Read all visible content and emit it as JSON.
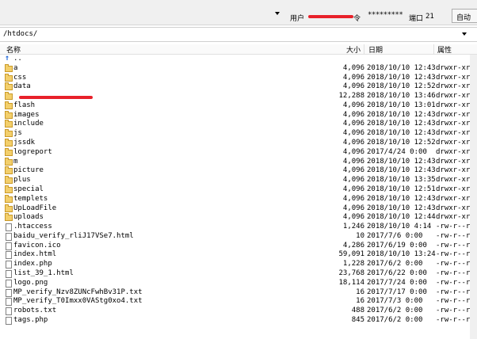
{
  "connection": {
    "user_label": "用户",
    "password_label": "令",
    "password_value": "*********",
    "port_label": "端口",
    "port_value": "21",
    "auto_button": "自动"
  },
  "remote": {
    "path": "/htdocs/"
  },
  "columns": {
    "name": "名称",
    "size": "大小",
    "date": "日期",
    "perm": "属性"
  },
  "files": [
    {
      "name": "..",
      "size": "",
      "date": "",
      "perm": "",
      "type": "up"
    },
    {
      "name": "a",
      "size": "4,096",
      "date": "2018/10/10 12:43",
      "perm": "drwxr-xr-x",
      "type": "folder"
    },
    {
      "name": "css",
      "size": "4,096",
      "date": "2018/10/10 12:43",
      "perm": "drwxr-xr-x",
      "type": "folder"
    },
    {
      "name": "data",
      "size": "4,096",
      "date": "2018/10/10 12:52",
      "perm": "drwxr-xr-x",
      "type": "folder"
    },
    {
      "name": "",
      "size": "12,288",
      "date": "2018/10/10 13:46",
      "perm": "drwxr-xr-x",
      "type": "folder",
      "redacted": true
    },
    {
      "name": "flash",
      "size": "4,096",
      "date": "2018/10/10 13:01",
      "perm": "drwxr-xr-x",
      "type": "folder"
    },
    {
      "name": "images",
      "size": "4,096",
      "date": "2018/10/10 12:43",
      "perm": "drwxr-xr-x",
      "type": "folder"
    },
    {
      "name": "include",
      "size": "4,096",
      "date": "2018/10/10 12:43",
      "perm": "drwxr-xr-x",
      "type": "folder"
    },
    {
      "name": "js",
      "size": "4,096",
      "date": "2018/10/10 12:43",
      "perm": "drwxr-xr-x",
      "type": "folder"
    },
    {
      "name": "jssdk",
      "size": "4,096",
      "date": "2018/10/10 12:52",
      "perm": "drwxr-xr-x",
      "type": "folder"
    },
    {
      "name": "logreport",
      "size": "4,096",
      "date": "2017/4/24 0:00",
      "perm": "drwxr-xr-x",
      "type": "folder"
    },
    {
      "name": "m",
      "size": "4,096",
      "date": "2018/10/10 12:43",
      "perm": "drwxr-xr-x",
      "type": "folder"
    },
    {
      "name": "picture",
      "size": "4,096",
      "date": "2018/10/10 12:43",
      "perm": "drwxr-xr-x",
      "type": "folder"
    },
    {
      "name": "plus",
      "size": "4,096",
      "date": "2018/10/10 13:35",
      "perm": "drwxr-xr-x",
      "type": "folder"
    },
    {
      "name": "special",
      "size": "4,096",
      "date": "2018/10/10 12:51",
      "perm": "drwxr-xr-x",
      "type": "folder"
    },
    {
      "name": "templets",
      "size": "4,096",
      "date": "2018/10/10 12:43",
      "perm": "drwxr-xr-x",
      "type": "folder"
    },
    {
      "name": "UpLoadFile",
      "size": "4,096",
      "date": "2018/10/10 12:43",
      "perm": "drwxr-xr-x",
      "type": "folder"
    },
    {
      "name": "uploads",
      "size": "4,096",
      "date": "2018/10/10 12:44",
      "perm": "drwxr-xr-x",
      "type": "folder"
    },
    {
      "name": ".htaccess",
      "size": "1,246",
      "date": "2018/10/10 4:14",
      "perm": "-rw-r--r--",
      "type": "file"
    },
    {
      "name": "baidu_verify_rliJ17VSe7.html",
      "size": "10",
      "date": "2017/7/6 0:00",
      "perm": "-rw-r--r--",
      "type": "file"
    },
    {
      "name": "favicon.ico",
      "size": "4,286",
      "date": "2017/6/19 0:00",
      "perm": "-rw-r--r--",
      "type": "file"
    },
    {
      "name": "index.html",
      "size": "59,091",
      "date": "2018/10/10 13:24",
      "perm": "-rw-r--r--",
      "type": "file"
    },
    {
      "name": "index.php",
      "size": "1,228",
      "date": "2017/6/2 0:00",
      "perm": "-rw-r--r--",
      "type": "file"
    },
    {
      "name": "list_39_1.html",
      "size": "23,768",
      "date": "2017/6/22 0:00",
      "perm": "-rw-r--r--",
      "type": "file"
    },
    {
      "name": "logo.png",
      "size": "18,114",
      "date": "2017/7/24 0:00",
      "perm": "-rw-r--r--",
      "type": "file"
    },
    {
      "name": "MP_verify_Nzv8ZUNcFwhBv31P.txt",
      "size": "16",
      "date": "2017/7/17 0:00",
      "perm": "-rw-r--r--",
      "type": "file"
    },
    {
      "name": "MP_verify_T0Imxx0VAStg0xo4.txt",
      "size": "16",
      "date": "2017/7/3 0:00",
      "perm": "-rw-r--r--",
      "type": "file"
    },
    {
      "name": "robots.txt",
      "size": "488",
      "date": "2017/6/2 0:00",
      "perm": "-rw-r--r--",
      "type": "file"
    },
    {
      "name": "tags.php",
      "size": "845",
      "date": "2017/6/2 0:00",
      "perm": "-rw-r--r--",
      "type": "file"
    }
  ]
}
